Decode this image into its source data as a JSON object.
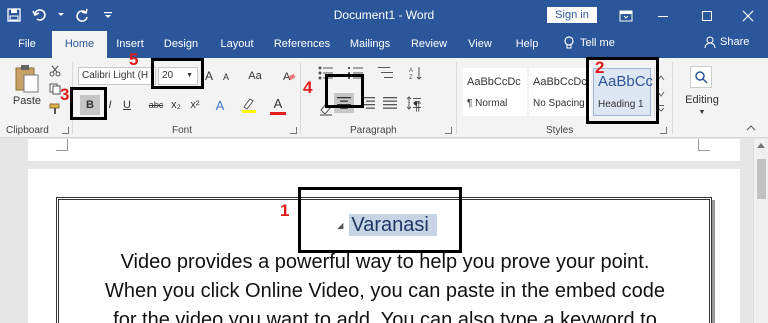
{
  "titlebar": {
    "document_title": "Document1 - Word",
    "signin_label": "Sign in"
  },
  "tabs": [
    {
      "label": "File"
    },
    {
      "label": "Home"
    },
    {
      "label": "Insert"
    },
    {
      "label": "Design"
    },
    {
      "label": "Layout"
    },
    {
      "label": "References"
    },
    {
      "label": "Mailings"
    },
    {
      "label": "Review"
    },
    {
      "label": "View"
    },
    {
      "label": "Help"
    }
  ],
  "tell_me": "Tell me",
  "share": "Share",
  "clipboard": {
    "paste_label": "Paste",
    "group_label": "Clipboard"
  },
  "font": {
    "font_name": "Calibri Light (H",
    "font_size": "20",
    "grow": "A",
    "shrink": "A",
    "change_case": "Aa",
    "bold": "B",
    "italic": "I",
    "underline": "U",
    "strikethrough": "abc",
    "subscript": "x₂",
    "superscript": "x²",
    "text_effects": "A",
    "font_color": "A",
    "group_label": "Font"
  },
  "paragraph": {
    "show_marks": "¶",
    "group_label": "Paragraph"
  },
  "styles": {
    "items": [
      {
        "sample": "AaBbCcDc",
        "name": "¶ Normal"
      },
      {
        "sample": "AaBbCcDc",
        "name": "No Spacing"
      },
      {
        "sample": "AaBbCc",
        "name": "Heading 1"
      }
    ],
    "group_label": "Styles"
  },
  "editing": {
    "label": "Editing"
  },
  "callouts": {
    "one": "1",
    "two": "2",
    "three": "3",
    "four": "4",
    "five": "5"
  },
  "document": {
    "heading": "Varanasi",
    "body_lines": [
      "Video provides a powerful way to help you prove your point.",
      "When you click Online Video, you can paste in the embed code",
      "for the video you want to add. You can also type a keyword to"
    ]
  },
  "colors": {
    "brand": "#2b579a",
    "callout_number": "#e21b1b",
    "heading_text": "#1f3864",
    "heading_highlight": "#c7d4e6"
  }
}
